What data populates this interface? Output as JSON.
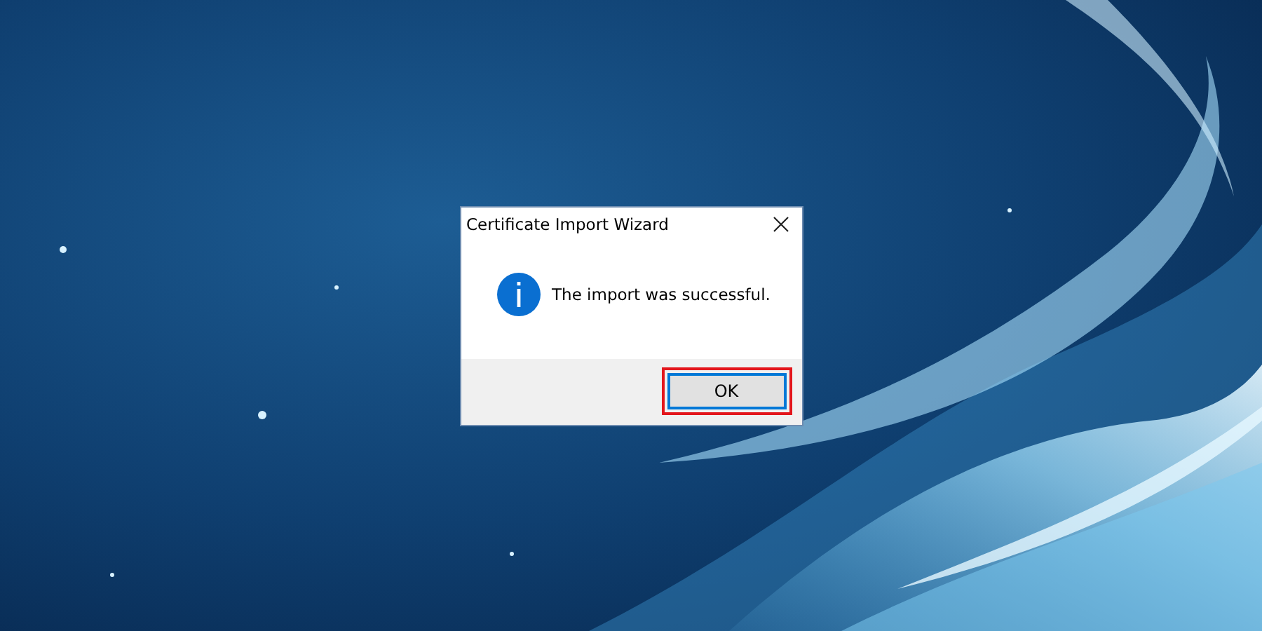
{
  "dialog": {
    "title": "Certificate Import Wizard",
    "message": "The import was successful.",
    "buttons": [
      {
        "label": "OK",
        "highlighted": true
      }
    ]
  }
}
